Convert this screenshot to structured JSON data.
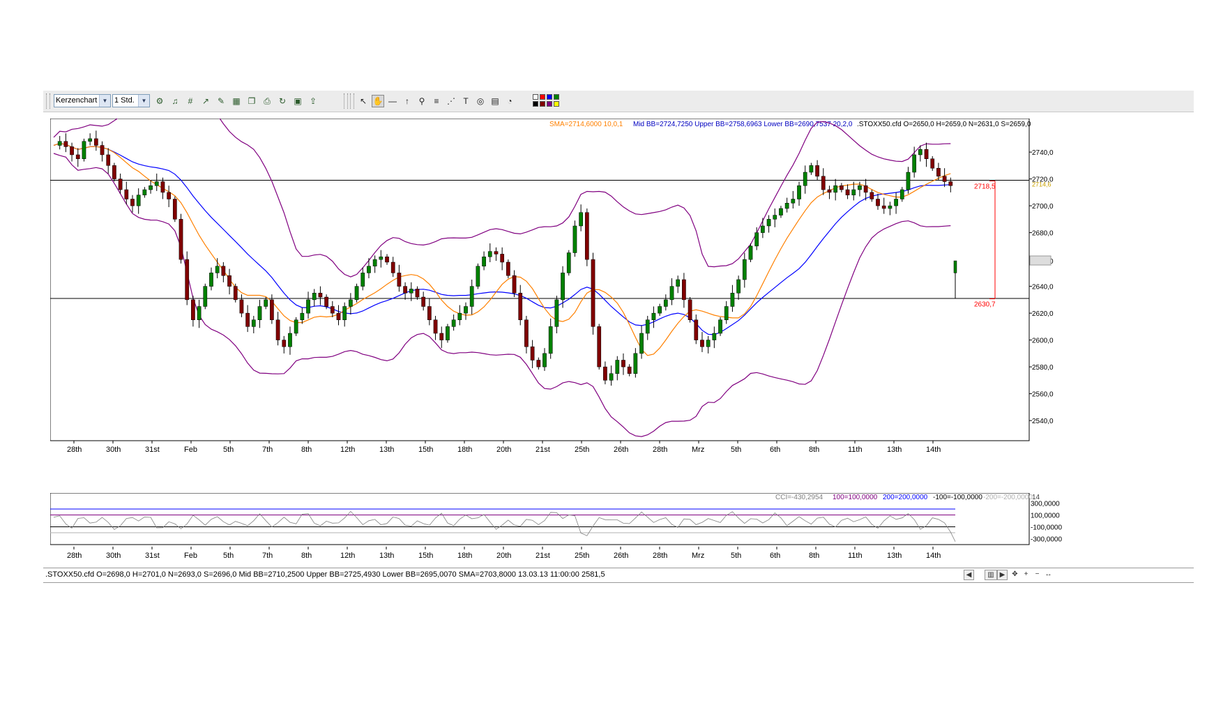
{
  "toolbar": {
    "chart_type_value": "Kerzenchart",
    "interval_value": "1 Std.",
    "icons_left": [
      "chart-settings-icon",
      "indicator-icon",
      "grid-icon",
      "trend-icon",
      "edit-icon",
      "template-icon",
      "copy-icon",
      "print-icon",
      "refresh-icon",
      "screenshot-icon",
      "export-icon"
    ],
    "icons_right": [
      "cursor-icon",
      "hand-icon",
      "hline-icon",
      "arrow-up-icon",
      "zoom-icon",
      "fibonacci-icon",
      "fan-icon",
      "text-icon",
      "cycle-icon",
      "calculator-icon",
      "pie-icon"
    ],
    "colors": [
      "#ffffff",
      "#ff0000",
      "#0000ff",
      "#008000",
      "#000000",
      "#800000",
      "#800080",
      "#ffff00"
    ]
  },
  "main_legend": {
    "sma": "SMA=2714,6000  10,0,1",
    "bb": "Mid BB=2724,7250  Upper BB=2758,6963  Lower BB=2690,7537   20,2,0",
    "ohlc": ".STOXX50.cfd O=2650,0 H=2659,0 N=2631,0 S=2659,0"
  },
  "cci_legend": {
    "cci": "CCI=-430,2954",
    "l100": "100=100,0000",
    "l200": "200=200,0000",
    "lm100": "-100=-100,0000",
    "lm200": "-200=-200,0000",
    "period": "14"
  },
  "price_axis": [
    "2740,0",
    "2720,0",
    "2700,0",
    "2680,0",
    "2659,0",
    "2640,0",
    "2620,0",
    "2600,0",
    "2580,0",
    "2560,0",
    "2540,0"
  ],
  "cci_axis": [
    "300,0000",
    "100,0000",
    "-100,0000",
    "-300,0000"
  ],
  "date_labels": [
    "28th",
    "30th",
    "31st",
    "Feb",
    "5th",
    "7th",
    "8th",
    "12th",
    "13th",
    "15th",
    "18th",
    "20th",
    "21st",
    "25th",
    "26th",
    "28th",
    "Mrz",
    "5th",
    "6th",
    "8th",
    "11th",
    "13th",
    "14th"
  ],
  "measure": {
    "upper": "2718,5",
    "lower": "2630,7",
    "price_pct": "2714,6"
  },
  "status": {
    "text": ".STOXX50.cfd O=2698,0 H=2701,0 N=2693,0 S=2696,0   Mid BB=2710,2500 Upper BB=2725,4930 Lower BB=2695,0070 SMA=2703,8000   13.03.13 11:00:00 2581,5"
  },
  "chart_data": {
    "type": "candlestick",
    "ylim": [
      2525,
      2765
    ],
    "horizontal_lines": [
      2719,
      2631
    ],
    "colors": {
      "up": "#008000",
      "down": "#800000",
      "sma": "#ff8000",
      "mid_bb": "#0000ff",
      "bands": "#800080",
      "measure": "#ff0000"
    },
    "close_path": [
      2745,
      2748,
      2744,
      2738,
      2735,
      2748,
      2750,
      2745,
      2738,
      2730,
      2720,
      2712,
      2705,
      2700,
      2708,
      2712,
      2715,
      2718,
      2710,
      2705,
      2690,
      2660,
      2630,
      2615,
      2625,
      2640,
      2650,
      2655,
      2648,
      2640,
      2630,
      2620,
      2610,
      2615,
      2625,
      2630,
      2615,
      2600,
      2595,
      2605,
      2615,
      2620,
      2630,
      2635,
      2632,
      2625,
      2620,
      2615,
      2625,
      2630,
      2640,
      2650,
      2655,
      2660,
      2662,
      2658,
      2650,
      2640,
      2635,
      2638,
      2632,
      2625,
      2615,
      2605,
      2600,
      2610,
      2615,
      2620,
      2625,
      2640,
      2655,
      2662,
      2666,
      2664,
      2658,
      2648,
      2635,
      2615,
      2595,
      2585,
      2580,
      2590,
      2610,
      2630,
      2650,
      2665,
      2685,
      2695,
      2660,
      2610,
      2580,
      2570,
      2575,
      2585,
      2580,
      2575,
      2590,
      2605,
      2615,
      2620,
      2625,
      2630,
      2640,
      2645,
      2630,
      2615,
      2600,
      2595,
      2600,
      2605,
      2615,
      2625,
      2635,
      2645,
      2660,
      2670,
      2680,
      2685,
      2690,
      2693,
      2698,
      2702,
      2705,
      2715,
      2725,
      2730,
      2722,
      2712,
      2710,
      2715,
      2712,
      2708,
      2712,
      2715,
      2710,
      2705,
      2700,
      2698,
      2700,
      2705,
      2712,
      2725,
      2738,
      2742,
      2735,
      2728,
      2722,
      2718,
      2715,
      2659
    ],
    "sma_period": 10,
    "bb_period": 20
  }
}
